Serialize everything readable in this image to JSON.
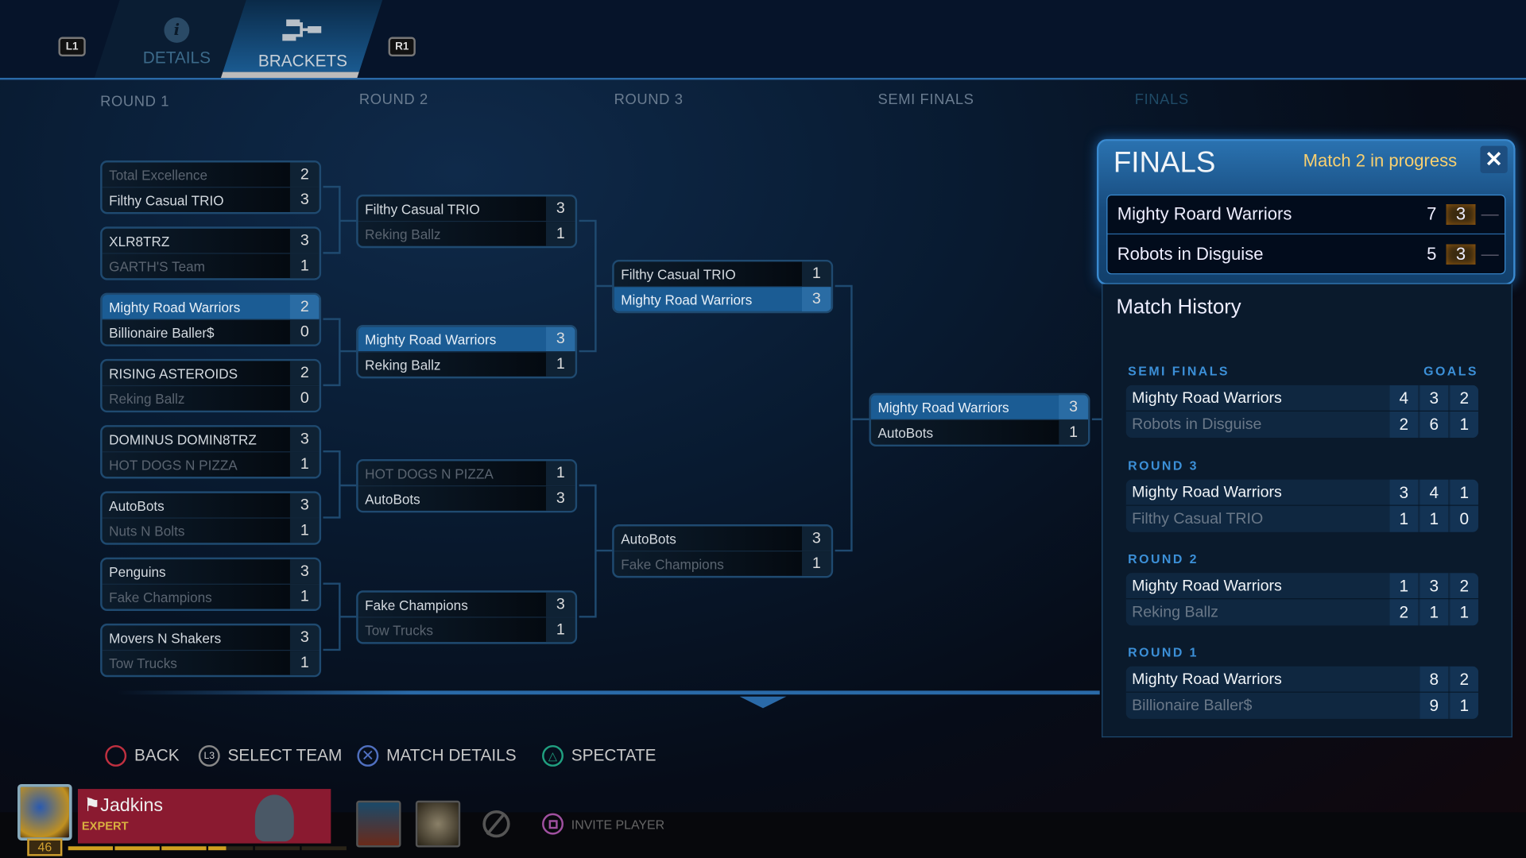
{
  "tabs": {
    "left_button": "L1",
    "right_button": "R1",
    "details": "DETAILS",
    "brackets": "BRACKETS",
    "active": "brackets"
  },
  "rounds": [
    "ROUND 1",
    "ROUND 2",
    "ROUND 3",
    "SEMI FINALS",
    "FINALS"
  ],
  "bracket": [
    [
      [
        [
          "Total Excellence",
          "2",
          "lose"
        ],
        [
          "Filthy Casual TRIO",
          "3",
          "win"
        ]
      ],
      [
        [
          "XLR8TRZ",
          "3",
          "win"
        ],
        [
          "GARTH'S Team",
          "1",
          "lose"
        ]
      ],
      [
        [
          "Mighty Road Warriors",
          "2",
          "hl"
        ],
        [
          "Billionaire Baller$",
          "0",
          "win"
        ]
      ],
      [
        [
          "RISING ASTEROIDS",
          "2",
          "win"
        ],
        [
          "Reking Ballz",
          "0",
          "lose"
        ]
      ],
      [
        [
          "DOMINUS DOMIN8TRZ",
          "3",
          "win"
        ],
        [
          "HOT DOGS N PIZZA",
          "1",
          "lose"
        ]
      ],
      [
        [
          "AutoBots",
          "3",
          "win"
        ],
        [
          "Nuts N Bolts",
          "1",
          "lose"
        ]
      ],
      [
        [
          "Penguins",
          "3",
          "win"
        ],
        [
          "Fake Champions",
          "1",
          "lose"
        ]
      ],
      [
        [
          "Movers N Shakers",
          "3",
          "win"
        ],
        [
          "Tow Trucks",
          "1",
          "lose"
        ]
      ]
    ],
    [
      [
        [
          "Filthy Casual TRIO",
          "3",
          "win"
        ],
        [
          "Reking Ballz",
          "1",
          "lose"
        ]
      ],
      [
        [
          "Mighty Road Warriors",
          "3",
          "hl"
        ],
        [
          "Reking Ballz",
          "1",
          "win"
        ]
      ],
      [
        [
          "HOT DOGS N PIZZA",
          "1",
          "lose"
        ],
        [
          "AutoBots",
          "3",
          "win"
        ]
      ],
      [
        [
          "Fake Champions",
          "3",
          "win"
        ],
        [
          "Tow Trucks",
          "1",
          "lose"
        ]
      ]
    ],
    [
      [
        [
          "Filthy Casual TRIO",
          "1",
          "win"
        ],
        [
          "Mighty Road Warriors",
          "3",
          "hl"
        ]
      ],
      [
        [
          "AutoBots",
          "3",
          "win"
        ],
        [
          "Fake Champions",
          "1",
          "lose"
        ]
      ]
    ],
    [
      [
        [
          "Mighty Road Warriors",
          "3",
          "hl"
        ],
        [
          "AutoBots",
          "1",
          "win"
        ]
      ]
    ]
  ],
  "finals": {
    "title": "FINALS",
    "status": "Match 2 in progress",
    "close": "✕",
    "rows": [
      {
        "name": "Mighty Roard Warriors",
        "games": [
          "7",
          "3",
          "—"
        ]
      },
      {
        "name": "Robots in Disguise",
        "games": [
          "5",
          "3",
          "—"
        ]
      }
    ]
  },
  "history": {
    "title": "Match History",
    "goals_label": "GOALS",
    "sections": [
      {
        "label": "SEMI FINALS",
        "rows": [
          {
            "name": "Mighty Road Warriors",
            "goals": [
              "4",
              "3",
              "2"
            ]
          },
          {
            "name": "Robots in Disguise",
            "goals": [
              "2",
              "6",
              "1"
            ]
          }
        ]
      },
      {
        "label": "ROUND 3",
        "rows": [
          {
            "name": "Mighty Road Warriors",
            "goals": [
              "3",
              "4",
              "1"
            ]
          },
          {
            "name": "Filthy Casual TRIO",
            "goals": [
              "1",
              "1",
              "0"
            ]
          }
        ]
      },
      {
        "label": "ROUND 2",
        "rows": [
          {
            "name": "Mighty Road Warriors",
            "goals": [
              "1",
              "3",
              "2"
            ]
          },
          {
            "name": "Reking Ballz",
            "goals": [
              "2",
              "1",
              "1"
            ]
          }
        ]
      },
      {
        "label": "ROUND 1",
        "rows": [
          {
            "name": "Mighty Road Warriors",
            "goals": [
              "8",
              "2"
            ]
          },
          {
            "name": "Billionaire Baller$",
            "goals": [
              "9",
              "1"
            ]
          }
        ]
      }
    ]
  },
  "hints": {
    "back": "BACK",
    "select_team": "SELECT TEAM",
    "select_team_key": "L3",
    "match_details": "MATCH DETAILS",
    "spectate": "SPECTATE",
    "invite": "INVITE PLAYER"
  },
  "player": {
    "name": "Jadkins",
    "rank": "EXPERT",
    "level": "46",
    "xp_progress": 0.55
  },
  "colors": {
    "accent": "#2a6ca4",
    "status": "#f8d070",
    "card": "#8a1a30",
    "circle": "#c03040",
    "cross": "#5070c0",
    "triangle": "#20a080",
    "square": "#a050a0"
  }
}
